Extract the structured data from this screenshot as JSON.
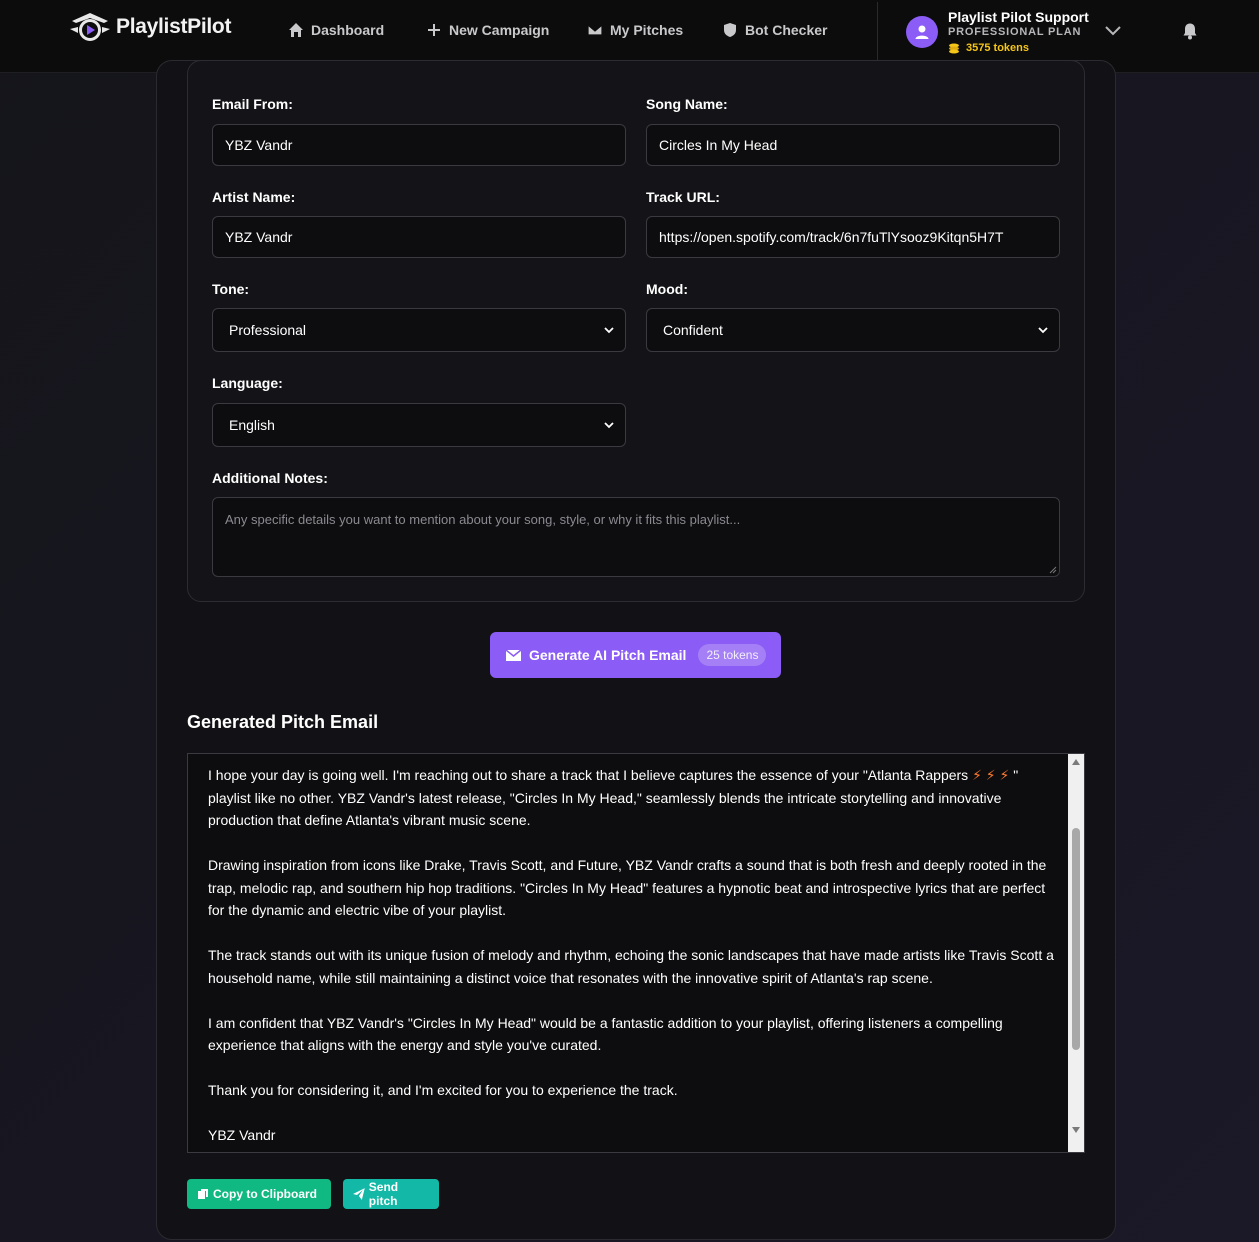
{
  "brand": {
    "name": "PlaylistPilot"
  },
  "nav": [
    {
      "label": "Dashboard",
      "icon": "home-icon"
    },
    {
      "label": "New Campaign",
      "icon": "plus-icon"
    },
    {
      "label": "My Pitches",
      "icon": "envelope-icon"
    },
    {
      "label": "Bot Checker",
      "icon": "shield-icon"
    }
  ],
  "user": {
    "name": "Playlist Pilot Support",
    "plan": "PROFESSIONAL PLAN",
    "tokens": "3575 tokens"
  },
  "form": {
    "email_from": {
      "label": "Email From:",
      "value": "YBZ Vandr"
    },
    "song_name": {
      "label": "Song Name:",
      "value": "Circles In My Head"
    },
    "artist_name": {
      "label": "Artist Name:",
      "value": "YBZ Vandr"
    },
    "track_url": {
      "label": "Track URL:",
      "value": "https://open.spotify.com/track/6n7fuTlYsooz9Kitqn5H7T"
    },
    "tone": {
      "label": "Tone:",
      "value": "Professional"
    },
    "mood": {
      "label": "Mood:",
      "value": "Confident"
    },
    "language": {
      "label": "Language:",
      "value": "English"
    },
    "notes": {
      "label": "Additional Notes:",
      "placeholder": "Any specific details you want to mention about your song, style, or why it fits this playlist..."
    }
  },
  "generate": {
    "label": "Generate AI Pitch Email",
    "cost": "25 tokens"
  },
  "output": {
    "title": "Generated Pitch Email",
    "line1_pre": "I hope your day is going well. I'm reaching out to share a track that I believe captures the essence of your \"Atlanta Rappers ",
    "line1_bolts": "⚡ ⚡ ⚡",
    "line1_post": " \"",
    "body": "playlist like no other. YBZ Vandr's latest release, \"Circles In My Head,\" seamlessly blends the intricate storytelling and innovative production that define Atlanta's vibrant music scene.\n\nDrawing inspiration from icons like Drake, Travis Scott, and Future, YBZ Vandr crafts a sound that is both fresh and deeply rooted in the trap, melodic rap, and southern hip hop traditions. \"Circles In My Head\" features a hypnotic beat and introspective lyrics that are perfect for the dynamic and electric vibe of your playlist.\n\nThe track stands out with its unique fusion of melody and rhythm, echoing the sonic landscapes that have made artists like Travis Scott a household name, while still maintaining a distinct voice that resonates with the innovative spirit of Atlanta's rap scene.\n\nI am confident that YBZ Vandr's \"Circles In My Head\" would be a fantastic addition to your playlist, offering listeners a compelling experience that aligns with the energy and style you've curated.\n\nThank you for considering it, and I'm excited for you to experience the track.\n\nYBZ Vandr"
  },
  "actions": {
    "copy": "Copy to Clipboard",
    "send": "Send pitch"
  },
  "colors": {
    "accent": "#8b5cf6",
    "copy": "#10b981",
    "send": "#14b8a6",
    "tokens": "#f5c518"
  }
}
